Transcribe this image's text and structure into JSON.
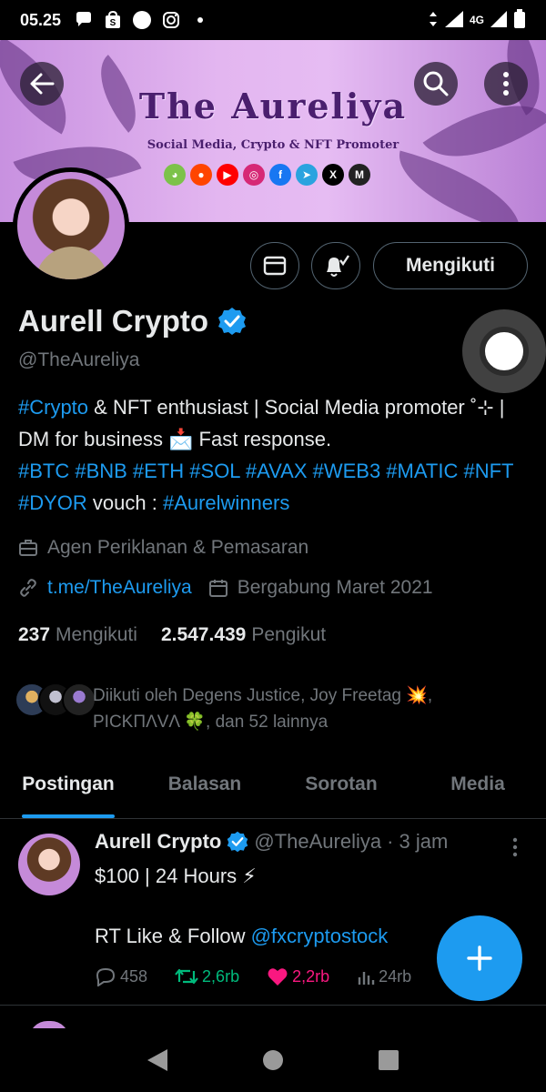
{
  "status_bar": {
    "time": "05.25",
    "network": "4G",
    "icons": [
      "chat-bubble-icon",
      "shopee-icon",
      "circle-icon",
      "instagram-icon",
      "dot-icon"
    ]
  },
  "banner": {
    "title": "The Aureliya",
    "subtitle": "Social Media, Crypto & NFT Promoter",
    "socials": [
      "parrot",
      "reddit",
      "youtube",
      "instagram",
      "facebook",
      "telegram",
      "x",
      "mask"
    ]
  },
  "header_buttons": {
    "back": "back-arrow-icon",
    "search": "search-icon",
    "more": "more-vertical-icon"
  },
  "actions": {
    "follow_label": "Mengikuti"
  },
  "profile": {
    "name": "Aurell Crypto",
    "handle": "@TheAureliya",
    "bio": {
      "line1_tag": "#Crypto",
      "line1_text": " & NFT enthusiast | Social Media promoter ˚⊹ | DM for business 📩 Fast response.",
      "tags_line": "#BTC #BNB #ETH #SOL #AVAX #WEB3 #MATIC #NFT #DYOR",
      "vouch_text": " vouch : ",
      "vouch_tag": "#Aurelwinners"
    },
    "category": "Agen Periklanan & Pemasaran",
    "link": "t.me/TheAureliya",
    "joined": "Bergabung Maret 2021",
    "following_count": "237",
    "following_label": "Mengikuti",
    "followers_count": "2.547.439",
    "followers_label": "Pengikut",
    "followed_by": "Diikuti oleh Degens Justice, Joy Freetag 💥, PICKΠΛVΛ 🍀, dan 52 lainnya"
  },
  "tabs": [
    {
      "label": "Postingan",
      "active": true
    },
    {
      "label": "Balasan",
      "active": false
    },
    {
      "label": "Sorotan",
      "active": false
    },
    {
      "label": "Media",
      "active": false
    }
  ],
  "post": {
    "name": "Aurell Crypto",
    "handle": "@TheAureliya",
    "time": "· 3 jam",
    "line1": "$100 | 24 Hours ⚡",
    "line2_text": "RT Like & Follow ",
    "line2_mention": "@fxcryptostock",
    "replies": "458",
    "reposts": "2,6rb",
    "likes": "2,2rb",
    "views": "24rb"
  },
  "colors": {
    "accent": "#1d9bf0",
    "muted": "#71767b",
    "repost": "#00ba7c",
    "like": "#f91880"
  }
}
